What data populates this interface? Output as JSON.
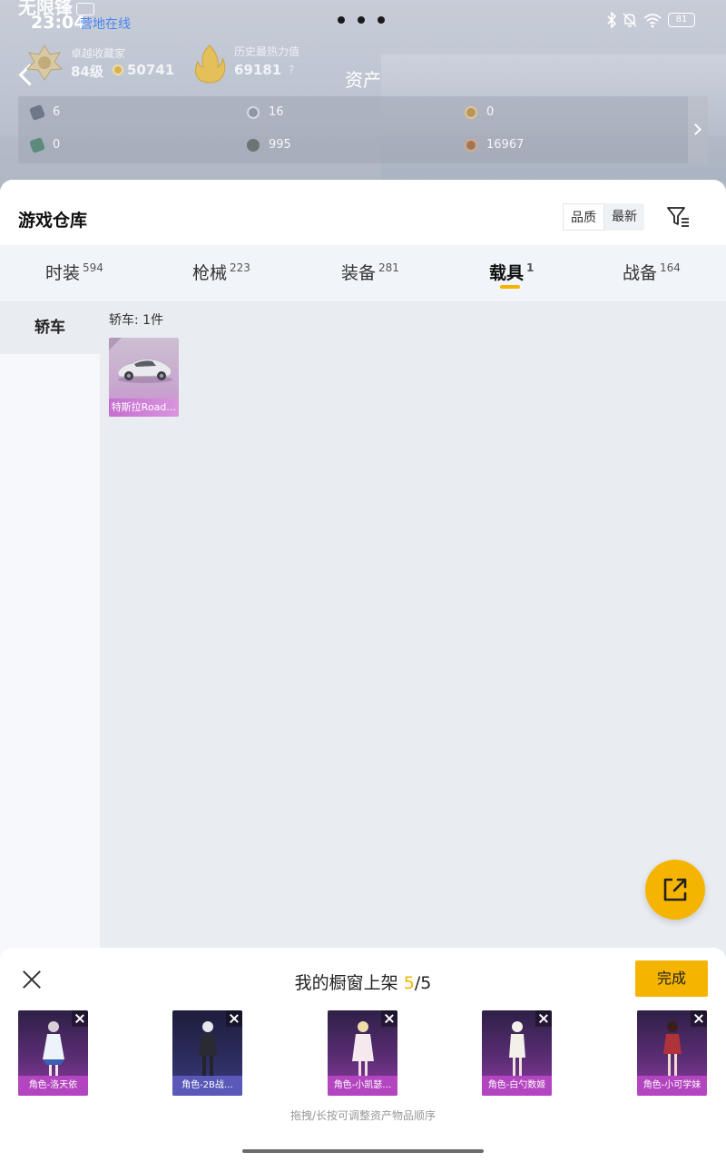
{
  "status_bar": {
    "time": "23:04",
    "camp_status": "营地在线",
    "battery": "81"
  },
  "profile": {
    "name": "无限锋",
    "collect_label": "卓越收藏家",
    "level": "84级",
    "coins": "50741",
    "heat_label": "历史最热力值",
    "heat_value": "69181",
    "help": "?"
  },
  "page_title": "资产",
  "resources": [
    {
      "icon": "card-gray-icon",
      "value": "6"
    },
    {
      "icon": "token-silver-icon",
      "value": "16"
    },
    {
      "icon": "token-gold-icon",
      "value": "0"
    },
    {
      "icon": "card-green-icon",
      "value": "0"
    },
    {
      "icon": "orb-gray-icon",
      "value": "995"
    },
    {
      "icon": "token-bronze-icon",
      "value": "16967"
    }
  ],
  "warehouse": {
    "title": "游戏仓库",
    "sort_options": [
      "品质",
      "最新"
    ],
    "sort_selected": "品质"
  },
  "tabs": [
    {
      "label": "时装",
      "count": "594"
    },
    {
      "label": "枪械",
      "count": "223"
    },
    {
      "label": "装备",
      "count": "281"
    },
    {
      "label": "载具",
      "count": "1",
      "active": true
    },
    {
      "label": "战备",
      "count": "164"
    }
  ],
  "sidebar": {
    "items": [
      {
        "label": "轿车"
      }
    ]
  },
  "content": {
    "category_count": "轿车: 1件",
    "items": [
      {
        "name": "特斯拉Road…"
      }
    ]
  },
  "showcase": {
    "title": "我的橱窗上架",
    "count": "5",
    "total": "/5",
    "done_label": "完成",
    "hint": "拖拽/长按可调整资产物品顺序",
    "slots": [
      {
        "label": "角色-洛天依"
      },
      {
        "label": "角色-2B战…"
      },
      {
        "label": "角色-小凯瑟…"
      },
      {
        "label": "角色-白勺数姬"
      },
      {
        "label": "角色-小可学妹"
      }
    ]
  },
  "colors": {
    "accent": "#f5b400",
    "link": "#4a86f0"
  }
}
